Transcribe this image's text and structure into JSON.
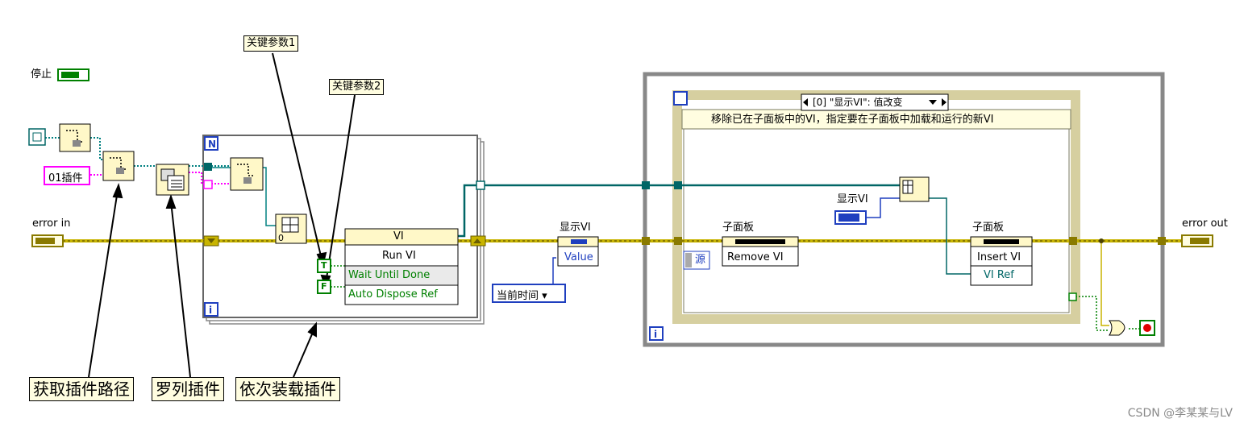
{
  "labels": {
    "stop": "停止",
    "error_in": "error in",
    "error_out": "error out",
    "plugin_folder": "01插件",
    "display_vi_label": "显示VI",
    "value_prop": "Value",
    "current_time": "当前时间",
    "subpanel_left": "子面板",
    "subpanel_right": "子面板",
    "remove_vi": "Remove VI",
    "insert_vi": "Insert VI",
    "vi_ref": "VI Ref",
    "display_vi_ctrl": "显示VI",
    "source": "源",
    "vi_node_title": "VI",
    "run_vi": "Run VI",
    "wait_until_done": "Wait Until Done",
    "auto_dispose_ref": "Auto Dispose Ref",
    "event_case": "[0] \"显示VI\": 值改变",
    "event_comment": "移除已在子面板中的VI，指定要在子面板中加载和运行的新VI",
    "loop_n": "N",
    "loop_i": "i",
    "while_i": "i",
    "const_zero": "0",
    "bool_t": "T",
    "bool_f": "F",
    "watermark": "CSDN @李某某与LV"
  },
  "notes": {
    "key_param_1": "关键参数1",
    "key_param_2": "关键参数2"
  },
  "callouts": {
    "get_path": "获取插件路径",
    "list_plugins": "罗列插件",
    "load_plugins": "依次装载插件"
  },
  "colors": {
    "error_wire": "#c8b400",
    "ref_wire": "#006666",
    "string_wire": "#ff00ff",
    "path_wire": "#008080",
    "bool_wire": "#008000",
    "loop_border": "#888888",
    "event_frame": "#d6cfa0",
    "node_fill": "#fff8c8",
    "index_blue": "#1f3fbf"
  }
}
